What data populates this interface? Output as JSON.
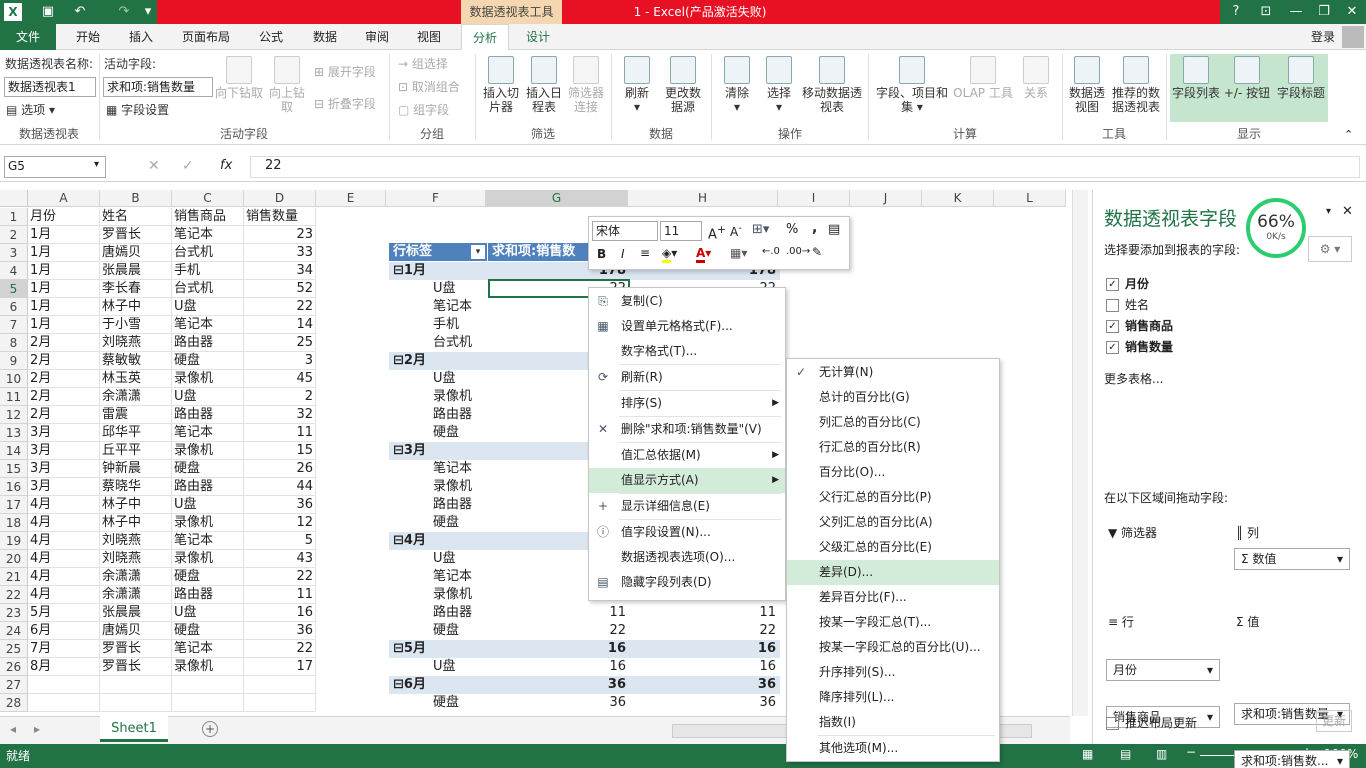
{
  "titlebar": {
    "excel_icon": "X",
    "context_tab": "数据透视表工具",
    "title": "1 - Excel(产品激活失败)",
    "help": "?"
  },
  "tabs": [
    "开始",
    "插入",
    "页面布局",
    "公式",
    "数据",
    "审阅",
    "视图",
    "分析",
    "设计"
  ],
  "file_tab": "文件",
  "login": "登录",
  "ribbon": {
    "pt_name_label": "数据透视表名称:",
    "pt_name": "数据透视表1",
    "options": "选项",
    "g1": "数据透视表",
    "active_field_label": "活动字段:",
    "active_field": "求和项:销售数量",
    "field_settings": "字段设置",
    "drill_down": "向下钻取",
    "drill_up": "向上钻取",
    "expand": "展开字段",
    "collapse": "折叠字段",
    "g2": "活动字段",
    "group_sel": "组选择",
    "ungroup": "取消组合",
    "group_field": "组字段",
    "g3": "分组",
    "slicer": "插入切片器",
    "timeline": "插入日程表",
    "filter_conn": "筛选器连接",
    "g4": "筛选",
    "refresh": "刷新",
    "change_src": "更改数据源",
    "g5": "数据",
    "clear": "清除",
    "select": "选择",
    "move": "移动数据透视表",
    "g6": "操作",
    "fields_items": "字段、项目和集",
    "olap": "OLAP 工具",
    "relations": "关系",
    "g7": "计算",
    "pivotchart": "数据透视图",
    "recommended": "推荐的数据透视表",
    "g8": "工具",
    "field_list": "字段列表",
    "pm_buttons": "+/- 按钮",
    "field_headers": "字段标题",
    "g9": "显示"
  },
  "formula": {
    "namebox": "G5",
    "fx": "fx",
    "value": "22"
  },
  "columns": [
    "A",
    "B",
    "C",
    "D",
    "E",
    "F",
    "G",
    "H",
    "I",
    "J",
    "K",
    "L"
  ],
  "rows": [
    [
      "月份",
      "姓名",
      "销售商品",
      "销售数量"
    ],
    [
      "1月",
      "罗晋长",
      "笔记本",
      "23"
    ],
    [
      "1月",
      "唐嫣贝",
      "台式机",
      "33"
    ],
    [
      "1月",
      "张晨晨",
      "手机",
      "34"
    ],
    [
      "1月",
      "李长春",
      "台式机",
      "52"
    ],
    [
      "1月",
      "林子中",
      "U盘",
      "22"
    ],
    [
      "1月",
      "于小雪",
      "笔记本",
      "14"
    ],
    [
      "2月",
      "刘晓燕",
      "路由器",
      "25"
    ],
    [
      "2月",
      "蔡敏敏",
      "硬盘",
      "3"
    ],
    [
      "2月",
      "林玉英",
      "录像机",
      "45"
    ],
    [
      "2月",
      "余潇潇",
      "U盘",
      "2"
    ],
    [
      "2月",
      "雷震",
      "路由器",
      "32"
    ],
    [
      "3月",
      "邱华平",
      "笔记本",
      "11"
    ],
    [
      "3月",
      "丘平平",
      "录像机",
      "15"
    ],
    [
      "3月",
      "钟新晨",
      "硬盘",
      "26"
    ],
    [
      "3月",
      "蔡晓华",
      "路由器",
      "44"
    ],
    [
      "4月",
      "林子中",
      "U盘",
      "36"
    ],
    [
      "4月",
      "林子中",
      "录像机",
      "12"
    ],
    [
      "4月",
      "刘晓燕",
      "笔记本",
      "5"
    ],
    [
      "4月",
      "刘晓燕",
      "录像机",
      "43"
    ],
    [
      "4月",
      "余潇潇",
      "硬盘",
      "22"
    ],
    [
      "4月",
      "余潇潇",
      "路由器",
      "11"
    ],
    [
      "5月",
      "张晨晨",
      "U盘",
      "16"
    ],
    [
      "6月",
      "唐嫣贝",
      "硬盘",
      "36"
    ],
    [
      "7月",
      "罗晋长",
      "笔记本",
      "22"
    ],
    [
      "8月",
      "罗晋长",
      "录像机",
      "17"
    ],
    [
      "",
      "",
      "",
      ""
    ],
    [
      "",
      "",
      "",
      ""
    ]
  ],
  "pivot": {
    "h1": "行标签",
    "h2": "求和项:销售数",
    "rows": [
      {
        "l": "⊟1月",
        "g": "178",
        "h": "178",
        "b": true
      },
      {
        "l": "U盘",
        "g": "22",
        "h": "22"
      },
      {
        "l": "笔记本",
        "g": "",
        "h": ""
      },
      {
        "l": "手机",
        "g": "",
        "h": ""
      },
      {
        "l": "台式机",
        "g": "",
        "h": ""
      },
      {
        "l": "⊟2月",
        "g": "",
        "h": "",
        "b": true
      },
      {
        "l": "U盘",
        "g": "",
        "h": ""
      },
      {
        "l": "录像机",
        "g": "",
        "h": ""
      },
      {
        "l": "路由器",
        "g": "",
        "h": ""
      },
      {
        "l": "硬盘",
        "g": "",
        "h": ""
      },
      {
        "l": "⊟3月",
        "g": "",
        "h": "",
        "b": true
      },
      {
        "l": "笔记本",
        "g": "",
        "h": ""
      },
      {
        "l": "录像机",
        "g": "",
        "h": ""
      },
      {
        "l": "路由器",
        "g": "",
        "h": ""
      },
      {
        "l": "硬盘",
        "g": "",
        "h": ""
      },
      {
        "l": "⊟4月",
        "g": "",
        "h": "",
        "b": true
      },
      {
        "l": "U盘",
        "g": "",
        "h": ""
      },
      {
        "l": "笔记本",
        "g": "",
        "h": ""
      },
      {
        "l": "录像机",
        "g": "",
        "h": ""
      },
      {
        "l": "路由器",
        "g": "11",
        "h": "11"
      },
      {
        "l": "硬盘",
        "g": "22",
        "h": "22"
      },
      {
        "l": "⊟5月",
        "g": "16",
        "h": "16",
        "b": true
      },
      {
        "l": "U盘",
        "g": "16",
        "h": "16"
      },
      {
        "l": "⊟6月",
        "g": "36",
        "h": "36",
        "b": true
      },
      {
        "l": "硬盘",
        "g": "36",
        "h": "36"
      }
    ]
  },
  "minitoolbar": {
    "font": "宋体",
    "size": "11",
    "bold": "B",
    "italic": "I",
    "pct": "%",
    "comma": ","
  },
  "contextmenu": [
    {
      "t": "复制(C)",
      "i": "⎘"
    },
    {
      "t": "设置单元格格式(F)...",
      "i": "▦"
    },
    {
      "t": "数字格式(T)...",
      "i": ""
    },
    {
      "sep": true
    },
    {
      "t": "刷新(R)",
      "i": "⟳"
    },
    {
      "sep": true
    },
    {
      "t": "排序(S)",
      "i": "",
      "sub": true
    },
    {
      "sep": true
    },
    {
      "t": "删除\"求和项:销售数量\"(V)",
      "i": "✕"
    },
    {
      "sep": true
    },
    {
      "t": "值汇总依据(M)",
      "i": "",
      "sub": true
    },
    {
      "t": "值显示方式(A)",
      "i": "",
      "sub": true,
      "hl": true
    },
    {
      "sep": true
    },
    {
      "t": "显示详细信息(E)",
      "i": "+"
    },
    {
      "sep": true
    },
    {
      "t": "值字段设置(N)...",
      "i": "ⓘ"
    },
    {
      "t": "数据透视表选项(O)...",
      "i": ""
    },
    {
      "t": "隐藏字段列表(D)",
      "i": "▤"
    }
  ],
  "submenu": [
    {
      "t": "无计算(N)",
      "chk": true
    },
    {
      "t": "总计的百分比(G)"
    },
    {
      "t": "列汇总的百分比(C)"
    },
    {
      "t": "行汇总的百分比(R)"
    },
    {
      "t": "百分比(O)..."
    },
    {
      "t": "父行汇总的百分比(P)"
    },
    {
      "t": "父列汇总的百分比(A)"
    },
    {
      "t": "父级汇总的百分比(E)"
    },
    {
      "t": "差异(D)...",
      "hl": true
    },
    {
      "t": "差异百分比(F)..."
    },
    {
      "t": "按某一字段汇总(T)..."
    },
    {
      "t": "按某一字段汇总的百分比(U)..."
    },
    {
      "t": "升序排列(S)..."
    },
    {
      "t": "降序排列(L)..."
    },
    {
      "t": "指数(I)"
    },
    {
      "sep": true
    },
    {
      "t": "其他选项(M)..."
    }
  ],
  "panel": {
    "title": "数据透视表字段",
    "subtitle": "选择要添加到报表的字段:",
    "fields": [
      {
        "n": "月份",
        "c": true
      },
      {
        "n": "姓名",
        "c": false
      },
      {
        "n": "销售商品",
        "c": true
      },
      {
        "n": "销售数量",
        "c": true
      }
    ],
    "more": "更多表格...",
    "drag": "在以下区域间拖动字段:",
    "filter": "筛选器",
    "cols": "列",
    "col_val": "Σ 数值",
    "rowsl": "行",
    "vals": "值",
    "row1": "月份",
    "row2": "销售商品",
    "val1": "求和项:销售数量",
    "val2": "求和项:销售数...",
    "defer": "推迟布局更新",
    "update": "更新",
    "speed": "66%",
    "speed_sub": "0K/s"
  },
  "sheet": "Sheet1",
  "status": {
    "ready": "就绪",
    "zoom": "100%"
  },
  "colors": {
    "excel_green": "#217346",
    "highlight": "#d3ebd9",
    "pivot_header": "#4f81bd"
  }
}
